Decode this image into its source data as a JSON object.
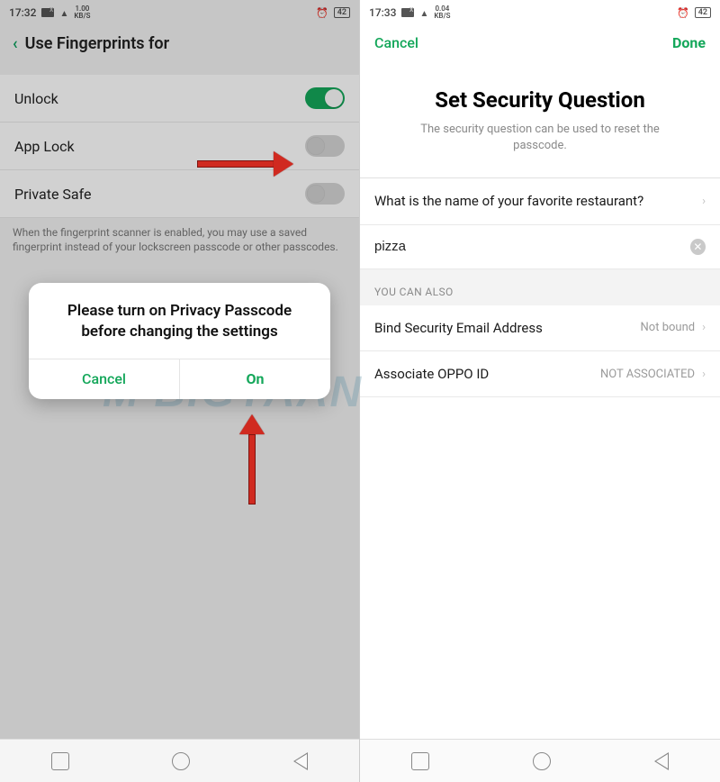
{
  "left": {
    "statusbar": {
      "time": "17:32",
      "kbs": "1.00",
      "battery": "42"
    },
    "header": {
      "title": "Use Fingerprints for"
    },
    "rows": [
      {
        "label": "Unlock",
        "toggle_on": true
      },
      {
        "label": "App Lock",
        "toggle_on": false
      },
      {
        "label": "Private Safe",
        "toggle_on": false
      }
    ],
    "footnote": "When the fingerprint scanner is enabled, you may use a saved fingerprint instead of your lockscreen passcode or other passcodes.",
    "dialog": {
      "text": "Please turn on Privacy Passcode before changing the settings",
      "cancel": "Cancel",
      "confirm": "On"
    }
  },
  "right": {
    "statusbar": {
      "time": "17:33",
      "kbs": "0.04",
      "battery": "42"
    },
    "header": {
      "cancel": "Cancel",
      "done": "Done"
    },
    "title": "Set Security Question",
    "subtitle": "The security question can be used to reset the passcode.",
    "question": "What is the name of your favorite restaurant?",
    "answer": "pizza",
    "also_header": "YOU CAN ALSO",
    "also": [
      {
        "label": "Bind Security Email Address",
        "value": "Not bound"
      },
      {
        "label": "Associate OPPO ID",
        "value": "NOT ASSOCIATED"
      }
    ]
  },
  "watermark": "M   BIGYAAN"
}
